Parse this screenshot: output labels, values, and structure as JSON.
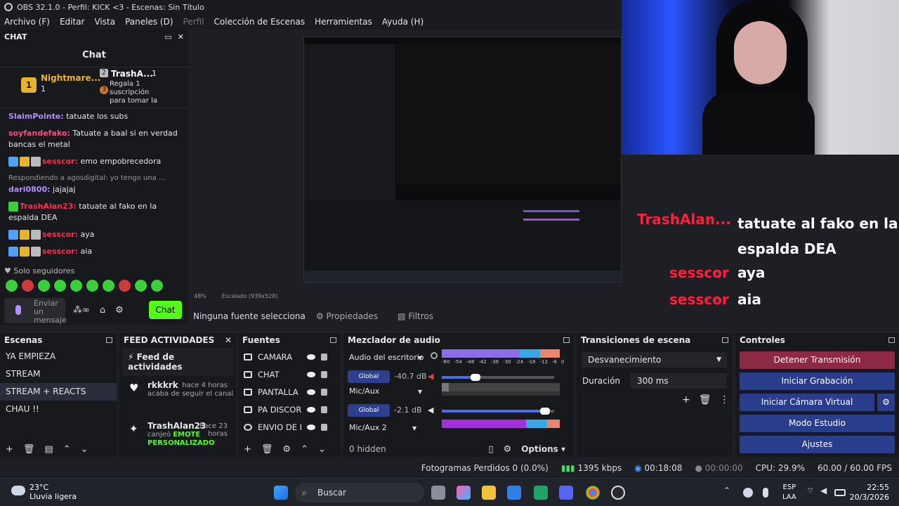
{
  "window": {
    "title": "OBS 32.1.0 - Perfil: KICK <3 - Escenas: Sin Título"
  },
  "menu": [
    "Archivo (F)",
    "Editar",
    "Vista",
    "Paneles (D)",
    "Perfil",
    "Colección de Escenas",
    "Herramientas",
    "Ayuda (H)"
  ],
  "chat": {
    "dock_title": "CHAT",
    "title": "Chat",
    "pinned": {
      "badge1": "1",
      "name1": "Nightmare...",
      "count1": "1",
      "badge2": "2",
      "name2": "TrashA...",
      "count2": "1",
      "badge3": "3",
      "sub": "Regala 1 suscripción para tomar la posición 3"
    },
    "messages": [
      {
        "user": "SlaimPointe:",
        "text": "tatuate los subs"
      },
      {
        "user": "soyfandefako:",
        "text": "Tatuate a baal si en verdad bancas el metal"
      },
      {
        "user": "sesscor:",
        "text": "emo empobrecedora"
      },
      {
        "reply": "Respondiendo a agosdigital: yo tengo una ...",
        "user": "dari0800:",
        "text": "jajajaj"
      },
      {
        "user": "TrashAlan23:",
        "text": "tatuate al fako en la espalda DEA"
      },
      {
        "user": "sesscor:",
        "text": "aya"
      },
      {
        "user": "sesscor:",
        "text": "aia"
      }
    ],
    "followers": "Solo seguidores",
    "input_placeholder": "Enviar un mensaje",
    "send_label": "Chat"
  },
  "preview": {
    "zoom": "48%",
    "scale": "Escalado (939x528)"
  },
  "source_toolbar": {
    "none": "Ninguna fuente selecciona",
    "props": "Propiedades",
    "filters": "Filtros"
  },
  "overlay": [
    {
      "name": "TrashAlan...",
      "text": "tatuate al fako en la espalda DEA"
    },
    {
      "name": "sesscor",
      "text": "aya"
    },
    {
      "name": "sesscor",
      "text": "aia"
    }
  ],
  "scenes": {
    "title": "Escenas",
    "items": [
      "YA EMPIEZA",
      "STREAM",
      "STREAM + REACTS",
      "CHAU !!"
    ],
    "selected": 2
  },
  "feed": {
    "title": "FEED ACTIVIDADES",
    "header": "Feed de actividades",
    "items": [
      {
        "name": "rkkkrk",
        "time": "hace 4 horas",
        "desc": "acaba de seguir el canal",
        "extra": ""
      },
      {
        "name": "TrashAlan23",
        "time": "hace 23 horas",
        "desc": "canjeó",
        "extra": "EMOTE PERSONALIZADO"
      }
    ]
  },
  "sources": {
    "title": "Fuentes",
    "items": [
      "CAMARA",
      "CHAT",
      "PANTALLA",
      "PA DISCORD",
      "ENVIO DE KI"
    ]
  },
  "mixer": {
    "title": "Mezclador de audio",
    "desktop": "Audio del escritorio",
    "mic1": "Mic/Aux",
    "mic2": "Mic/Aux 2",
    "global": "Global",
    "db1": "-40.7 dB",
    "db2": "-2.1 dB",
    "level1": 0.3,
    "level2": 0.92,
    "scale": [
      "-60",
      "-54",
      "-48",
      "-42",
      "-36",
      "-30",
      "-24",
      "-18",
      "-12",
      "-6",
      "0"
    ],
    "hidden": "0 hidden",
    "options": "Options"
  },
  "transitions": {
    "title": "Transiciones de escena",
    "selected": "Desvanecimiento",
    "duration_label": "Duración",
    "duration": "300 ms"
  },
  "controls": {
    "title": "Controles",
    "buttons": [
      "Detener Transmisión",
      "Iniciar Grabación",
      "Iniciar Cámara Virtual",
      "Modo Estudio",
      "Ajustes"
    ]
  },
  "status": {
    "dropped": "Fotogramas Perdidos 0 (0.0%)",
    "kbps": "1395 kbps",
    "stream_time": "00:18:08",
    "rec_time": "00:00:00",
    "cpu": "CPU: 29.9%",
    "fps": "60.00 / 60.00 FPS"
  },
  "taskbar": {
    "temp": "23°C",
    "weather": "Lluvia ligera",
    "search": "Buscar",
    "lang1": "ESP",
    "lang2": "LAA",
    "time": "22:55",
    "date": "20/3/2026"
  },
  "colors": {
    "accent": "#53fc18",
    "stop": "#8c2a46",
    "btn": "#2a3c8c",
    "username": "#b38cff",
    "overlay_name": "#ff1f3a"
  }
}
